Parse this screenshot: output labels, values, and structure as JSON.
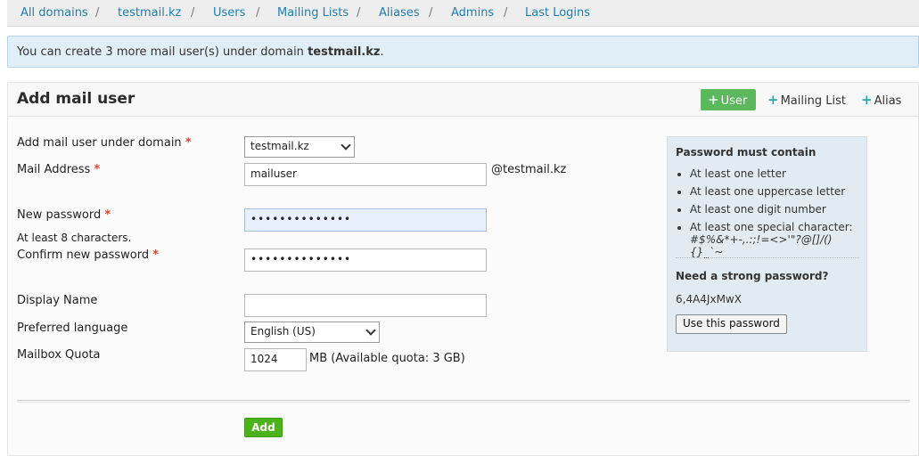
{
  "nav": {
    "items": [
      "All domains",
      "testmail.kz",
      "Users",
      "Mailing Lists",
      "Aliases",
      "Admins",
      "Last Logins"
    ],
    "separator": "/"
  },
  "notice": {
    "prefix": "You can create 3 more mail user(s) under domain ",
    "domain": "testmail.kz",
    "suffix": "."
  },
  "panel": {
    "title": "Add mail user",
    "buttons": {
      "user": "User",
      "mailing_list": "Mailing List",
      "alias": "Alias",
      "plus": "+"
    }
  },
  "form": {
    "domain_label": "Add mail user under domain",
    "domain_value": "testmail.kz",
    "mail_address_label": "Mail Address",
    "mail_address_value": "mailuser",
    "mail_suffix": "@testmail.kz",
    "new_password_label": "New password",
    "new_password_value": "••••••••••••••",
    "password_hint": "At least 8 characters.",
    "confirm_password_label": "Confirm new password",
    "confirm_password_value": "••••••••••••••",
    "display_name_label": "Display Name",
    "display_name_value": "",
    "language_label": "Preferred language",
    "language_value": "English (US)",
    "quota_label": "Mailbox Quota",
    "quota_value": "1024",
    "quota_suffix": "MB (Available quota: 3 GB)",
    "required_mark": "*",
    "add_button": "Add"
  },
  "password_rules": {
    "title": "Password must contain",
    "rules": [
      "At least one letter",
      "At least one uppercase letter",
      "At least one digit number",
      "At least one special character:"
    ],
    "special_chars": "#$%&*+-,.:;!=<>'\"?@[]/(){}_`~",
    "strong_title": "Need a strong password?",
    "generated_password": "6,4A4JxMwX",
    "use_button": "Use this password"
  },
  "colors": {
    "link": "#1f7fb3",
    "user_button": "#5cb85c",
    "add_button": "#4cb21a",
    "required": "#d43",
    "notice_bg": "#e0eef7"
  }
}
